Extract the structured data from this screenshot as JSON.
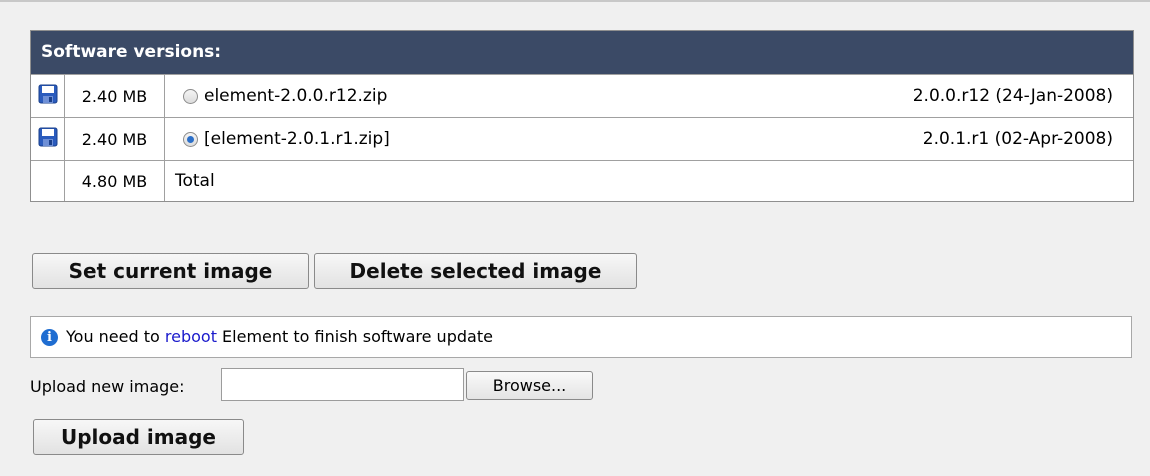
{
  "versions": {
    "header": "Software versions:",
    "rows": [
      {
        "size": "2.40 MB",
        "name": "element-2.0.0.r12.zip",
        "version": "2.0.0.r12 (24-Jan-2008)",
        "selected": false,
        "icon": "floppy-disk-icon"
      },
      {
        "size": "2.40 MB",
        "name": "[element-2.0.1.r1.zip]",
        "version": "2.0.1.r1 (02-Apr-2008)",
        "selected": true,
        "icon": "floppy-disk-icon"
      }
    ],
    "total": {
      "size": "4.80 MB",
      "label": "Total"
    }
  },
  "buttons": {
    "set_current": "Set current image",
    "delete_selected": "Delete selected image",
    "upload": "Upload image"
  },
  "notice": {
    "icon": "info-icon",
    "before": "You need to ",
    "link": "reboot",
    "after": " Element to finish software update"
  },
  "upload": {
    "label": "Upload new image:",
    "value": "",
    "browse": "Browse..."
  },
  "colors": {
    "header_bg": "#3b4a66",
    "link": "#1b1bcc",
    "page_bg": "#f0f0f0"
  }
}
